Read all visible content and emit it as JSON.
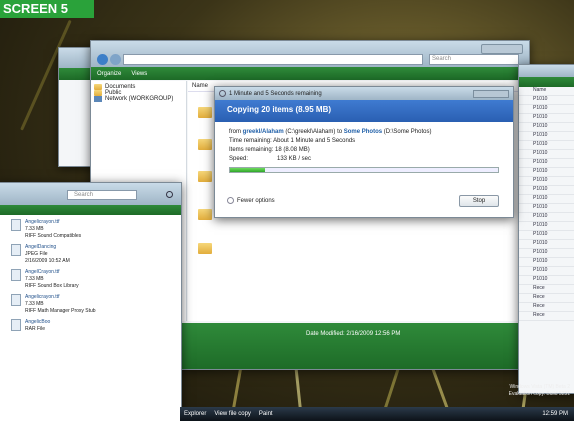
{
  "badge": "SCREEN 5",
  "back_window": {
    "toolbar": {
      "organize": "Organize",
      "views": "Views",
      "search": "Search"
    },
    "nav": [
      "Documents",
      "Public",
      "Network (WORKGROUP)"
    ],
    "column_name": "Name",
    "status": "Date Modified: 2/16/2009 12:56 PM"
  },
  "left_window": {
    "search": "Search",
    "files": [
      {
        "name": "Angelicrayon.ttf",
        "meta": "7.33 MB",
        "sub": "RIFF Sound Compatibles"
      },
      {
        "name": "AngelDancing",
        "meta": "JPEG File",
        "sub": "2/16/2009 10:52 AM"
      },
      {
        "name": "AngelCrayon.ttf",
        "meta": "7.33 MB",
        "sub": "RIFF Sound Box Library"
      },
      {
        "name": "Angelicrayon.ttf",
        "meta": "7.33 MB",
        "sub": "RIFF Math Manager Proxy Stub"
      },
      {
        "name": "AngelicBoo",
        "meta": "RAR File",
        "sub": ""
      }
    ]
  },
  "right_list": [
    "Name",
    "P1010",
    "P1010",
    "P1010",
    "P1010",
    "P1010",
    "P1010",
    "P1010",
    "P1010",
    "P1010",
    "P1010",
    "P1010",
    "P1010",
    "P1010",
    "P1010",
    "P1010",
    "P1010",
    "P1010",
    "P1010",
    "P1010",
    "P1010",
    "P1010",
    "Rece",
    "Rece",
    "Rece",
    "Rece"
  ],
  "copy_dialog": {
    "title": "1 Minute and 5 Seconds remaining",
    "heading": "Copying 20 items (8.95 MB)",
    "from_label": "from",
    "from_src": "greekl/Alaham",
    "from_path": "(C:\\greekl\\Alaham)",
    "to_label": "to",
    "to_dest": "Some Photos",
    "to_path": "(D:\\Some Photos)",
    "time_remaining": "Time remaining: About 1 Minute and 5 Seconds",
    "items_remaining": "Items remaining: 18 (8.08 MB)",
    "speed_label": "Speed:",
    "speed_value": "133 KB / sec",
    "progress": 0.13,
    "fewer_options": "Fewer options",
    "stop": "Stop"
  },
  "taskbar": {
    "explorer": "Explorer",
    "view_file_copy": "View file copy",
    "paint": "Paint",
    "clock": "12:59 PM",
    "watermark_1": "Windows Vista (TM) Beta 2",
    "watermark_2": "Evaluation copy. Build 5231"
  },
  "colors": {
    "badge_bg": "#2aa23a",
    "vista_green": "#2f8a3a",
    "dialog_blue": "#2f63b8"
  }
}
